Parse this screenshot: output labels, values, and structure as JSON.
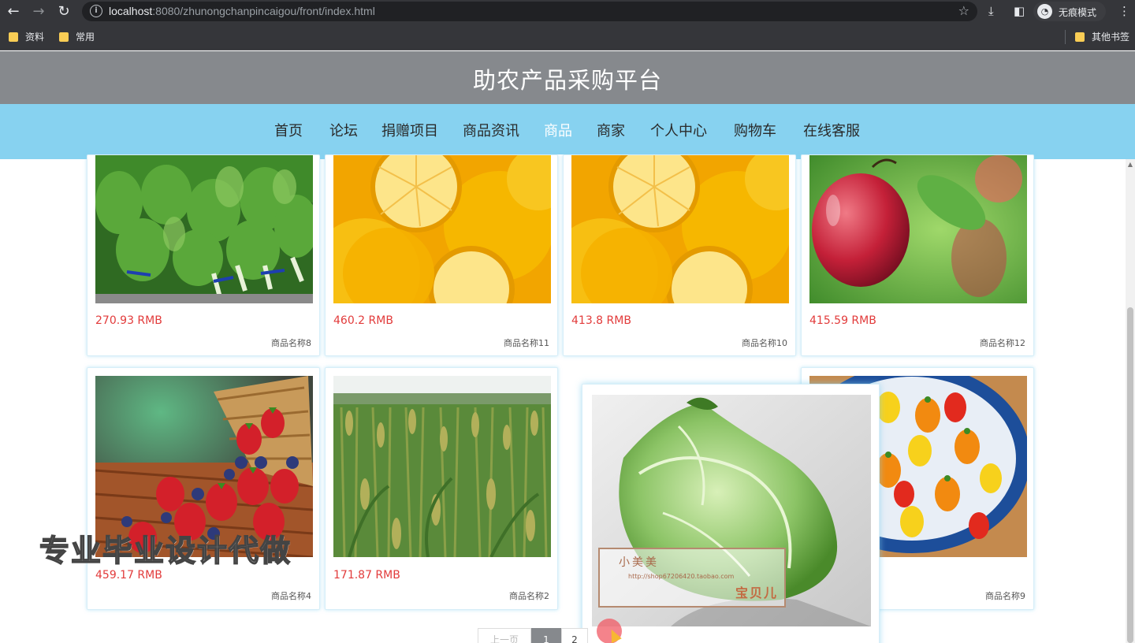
{
  "browser": {
    "url_host": "localhost",
    "url_rest": ":8080/zhunongchanpincaigou/front/index.html",
    "incognito_label": "无痕模式",
    "bookmarks": [
      "资料",
      "常用"
    ],
    "other_bookmarks": "其他书签"
  },
  "site": {
    "title": "助农产品采购平台",
    "nav": [
      "首页",
      "论坛",
      "捐赠项目",
      "商品资讯",
      "商品",
      "商家",
      "个人中心",
      "购物车",
      "在线客服"
    ],
    "active_nav": "商品"
  },
  "products": [
    {
      "price": "270.93 RMB",
      "name": "商品名称8"
    },
    {
      "price": "460.2 RMB",
      "name": "商品名称11"
    },
    {
      "price": "413.8 RMB",
      "name": "商品名称10"
    },
    {
      "price": "415.59 RMB",
      "name": "商品名称12"
    },
    {
      "price": "459.17 RMB",
      "name": "商品名称4"
    },
    {
      "price": "171.87 RMB",
      "name": "商品名称2"
    },
    {
      "price": "",
      "name": "商品名称9"
    }
  ],
  "popup_stamp": {
    "line1": "小美美",
    "line2": "http://shop67206420.taobao.com",
    "line3": "宝贝儿"
  },
  "pagination": {
    "prev": "上一页",
    "page1": "1",
    "page2": "2"
  },
  "watermark": "专业毕业设计代做"
}
